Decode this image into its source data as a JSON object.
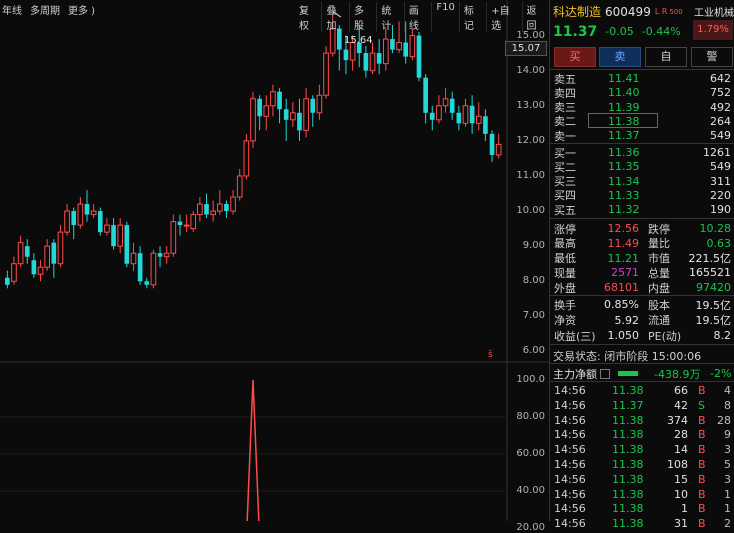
{
  "toolbar_left": [
    "年线",
    "多周期",
    "更多 )"
  ],
  "toolbar_right": [
    "复权",
    "叠加",
    "多股",
    "统计",
    "画线",
    "F10",
    "标记",
    "+自选",
    "返回"
  ],
  "price_axis": [
    "15.00",
    "14.00",
    "13.00",
    "12.00",
    "11.00",
    "10.00",
    "9.00",
    "8.00",
    "7.00",
    "6.00"
  ],
  "current_price_tag": "15.07",
  "high_annotation": "15.64",
  "volume_axis": [
    "100.0",
    "80.00",
    "60.00",
    "40.00",
    "20.00"
  ],
  "small_marker": "š",
  "colors": {
    "up": "#ff4b4b",
    "down": "#22d8d8",
    "green": "#18c64a",
    "bg": "#0b0b0b"
  },
  "stock": {
    "name": "科达制造",
    "code": "600499",
    "tag": "L R",
    "tag_sub": "500",
    "industry": "工业机械",
    "industry_change": "1.79%",
    "price": "11.37",
    "change": "-0.05",
    "change_pct": "-0.44%"
  },
  "buttons": [
    "买",
    "卖",
    "自",
    "警"
  ],
  "sell_orders": [
    {
      "label": "卖五",
      "price": "11.41",
      "vol": "642"
    },
    {
      "label": "卖四",
      "price": "11.40",
      "vol": "752"
    },
    {
      "label": "卖三",
      "price": "11.39",
      "vol": "492"
    },
    {
      "label": "卖二",
      "price": "11.38",
      "vol": "264"
    },
    {
      "label": "卖一",
      "price": "11.37",
      "vol": "549"
    }
  ],
  "buy_orders": [
    {
      "label": "买一",
      "price": "11.36",
      "vol": "1261"
    },
    {
      "label": "买二",
      "price": "11.35",
      "vol": "549"
    },
    {
      "label": "买三",
      "price": "11.34",
      "vol": "311"
    },
    {
      "label": "买四",
      "price": "11.33",
      "vol": "220"
    },
    {
      "label": "买五",
      "price": "11.32",
      "vol": "190"
    }
  ],
  "stats": [
    {
      "l1": "涨停",
      "v1": "12.56",
      "c1": "red",
      "l2": "跌停",
      "v2": "10.28",
      "c2": "green"
    },
    {
      "l1": "最高",
      "v1": "11.49",
      "c1": "red",
      "l2": "量比",
      "v2": "0.63",
      "c2": "green"
    },
    {
      "l1": "最低",
      "v1": "11.21",
      "c1": "green",
      "l2": "市值",
      "v2": "221.5亿",
      "c2": "white"
    },
    {
      "l1": "现量",
      "v1": "2571",
      "c1": "purple",
      "l2": "总量",
      "v2": "165521",
      "c2": "white"
    },
    {
      "l1": "外盘",
      "v1": "68101",
      "c1": "red",
      "l2": "内盘",
      "v2": "97420",
      "c2": "green"
    }
  ],
  "stats2": [
    {
      "l1": "换手",
      "v1": "0.85%",
      "l2": "股本",
      "v2": "19.5亿"
    },
    {
      "l1": "净资",
      "v1": "5.92",
      "l2": "流通",
      "v2": "19.5亿"
    },
    {
      "l1": "收益(三)",
      "v1": "1.050",
      "l2": "PE(动)",
      "v2": "8.2"
    }
  ],
  "trade_status": "交易状态: 闭市阶段 15:00:06",
  "main_flow": {
    "label": "主力净额",
    "value": "-438.9万",
    "pct": "-2%"
  },
  "ticks": [
    {
      "t": "14:56",
      "p": "11.38",
      "v": "66",
      "s": "B",
      "n": "4"
    },
    {
      "t": "14:56",
      "p": "11.37",
      "v": "42",
      "s": "S",
      "n": "8"
    },
    {
      "t": "14:56",
      "p": "11.38",
      "v": "374",
      "s": "B",
      "n": "28"
    },
    {
      "t": "14:56",
      "p": "11.38",
      "v": "28",
      "s": "B",
      "n": "9"
    },
    {
      "t": "14:56",
      "p": "11.38",
      "v": "14",
      "s": "B",
      "n": "3"
    },
    {
      "t": "14:56",
      "p": "11.38",
      "v": "108",
      "s": "B",
      "n": "5"
    },
    {
      "t": "14:56",
      "p": "11.38",
      "v": "15",
      "s": "B",
      "n": "3"
    },
    {
      "t": "14:56",
      "p": "11.38",
      "v": "10",
      "s": "B",
      "n": "1"
    },
    {
      "t": "14:56",
      "p": "11.38",
      "v": "1",
      "s": "B",
      "n": "1"
    },
    {
      "t": "14:56",
      "p": "11.38",
      "v": "31",
      "s": "B",
      "n": "2"
    }
  ],
  "chart_data": {
    "type": "candlestick",
    "ylim": [
      5.9,
      15.5
    ],
    "candles": [
      {
        "o": 8.1,
        "c": 7.9,
        "h": 8.3,
        "l": 7.8
      },
      {
        "o": 8.0,
        "c": 8.5,
        "h": 8.7,
        "l": 7.9
      },
      {
        "o": 8.5,
        "c": 9.1,
        "h": 9.3,
        "l": 8.4
      },
      {
        "o": 9.0,
        "c": 8.7,
        "h": 9.2,
        "l": 8.5
      },
      {
        "o": 8.6,
        "c": 8.2,
        "h": 8.8,
        "l": 8.1
      },
      {
        "o": 8.2,
        "c": 8.4,
        "h": 8.6,
        "l": 8.0
      },
      {
        "o": 8.4,
        "c": 9.0,
        "h": 9.2,
        "l": 8.3
      },
      {
        "o": 9.1,
        "c": 8.5,
        "h": 9.2,
        "l": 8.1
      },
      {
        "o": 8.5,
        "c": 9.4,
        "h": 9.6,
        "l": 8.4
      },
      {
        "o": 9.4,
        "c": 10.0,
        "h": 10.2,
        "l": 9.3
      },
      {
        "o": 10.0,
        "c": 9.6,
        "h": 10.1,
        "l": 9.2
      },
      {
        "o": 9.6,
        "c": 10.2,
        "h": 10.4,
        "l": 9.5
      },
      {
        "o": 10.2,
        "c": 9.9,
        "h": 10.6,
        "l": 9.7
      },
      {
        "o": 9.9,
        "c": 10.0,
        "h": 10.2,
        "l": 9.8
      },
      {
        "o": 10.0,
        "c": 9.4,
        "h": 10.1,
        "l": 9.3
      },
      {
        "o": 9.4,
        "c": 9.6,
        "h": 9.8,
        "l": 9.3
      },
      {
        "o": 9.6,
        "c": 9.0,
        "h": 9.8,
        "l": 8.9
      },
      {
        "o": 9.0,
        "c": 9.6,
        "h": 9.8,
        "l": 8.8
      },
      {
        "o": 9.6,
        "c": 8.5,
        "h": 9.7,
        "l": 8.4
      },
      {
        "o": 8.5,
        "c": 8.8,
        "h": 9.1,
        "l": 8.3
      },
      {
        "o": 8.8,
        "c": 8.0,
        "h": 9.0,
        "l": 7.9
      },
      {
        "o": 8.0,
        "c": 7.9,
        "h": 8.1,
        "l": 7.8
      },
      {
        "o": 7.9,
        "c": 8.8,
        "h": 8.9,
        "l": 7.8
      },
      {
        "o": 8.8,
        "c": 8.7,
        "h": 9.0,
        "l": 8.4
      },
      {
        "o": 8.7,
        "c": 8.8,
        "h": 9.0,
        "l": 8.5
      },
      {
        "o": 8.8,
        "c": 9.7,
        "h": 9.9,
        "l": 8.7
      },
      {
        "o": 9.7,
        "c": 9.6,
        "h": 9.9,
        "l": 9.3
      },
      {
        "o": 9.6,
        "c": 9.6,
        "h": 9.9,
        "l": 9.4
      },
      {
        "o": 9.5,
        "c": 9.9,
        "h": 10.0,
        "l": 9.4
      },
      {
        "o": 9.9,
        "c": 10.2,
        "h": 10.4,
        "l": 9.7
      },
      {
        "o": 10.2,
        "c": 9.9,
        "h": 10.5,
        "l": 9.8
      },
      {
        "o": 9.9,
        "c": 10.0,
        "h": 10.3,
        "l": 9.7
      },
      {
        "o": 10.0,
        "c": 10.2,
        "h": 10.6,
        "l": 9.9
      },
      {
        "o": 10.2,
        "c": 10.0,
        "h": 10.3,
        "l": 9.8
      },
      {
        "o": 10.0,
        "c": 10.4,
        "h": 10.6,
        "l": 9.9
      },
      {
        "o": 10.4,
        "c": 11.0,
        "h": 11.2,
        "l": 10.3
      },
      {
        "o": 11.0,
        "c": 12.0,
        "h": 12.2,
        "l": 10.9
      },
      {
        "o": 12.0,
        "c": 13.2,
        "h": 13.4,
        "l": 11.8
      },
      {
        "o": 13.2,
        "c": 12.7,
        "h": 13.3,
        "l": 12.3
      },
      {
        "o": 12.7,
        "c": 13.0,
        "h": 13.3,
        "l": 12.3
      },
      {
        "o": 13.0,
        "c": 13.4,
        "h": 13.6,
        "l": 12.7
      },
      {
        "o": 13.4,
        "c": 12.9,
        "h": 13.5,
        "l": 12.5
      },
      {
        "o": 12.9,
        "c": 12.6,
        "h": 13.2,
        "l": 12.0
      },
      {
        "o": 12.6,
        "c": 12.8,
        "h": 13.1,
        "l": 12.4
      },
      {
        "o": 12.8,
        "c": 12.3,
        "h": 13.2,
        "l": 12.0
      },
      {
        "o": 12.3,
        "c": 13.2,
        "h": 13.5,
        "l": 12.1
      },
      {
        "o": 13.2,
        "c": 12.8,
        "h": 13.3,
        "l": 12.4
      },
      {
        "o": 12.8,
        "c": 13.3,
        "h": 13.6,
        "l": 12.6
      },
      {
        "o": 13.3,
        "c": 14.5,
        "h": 14.7,
        "l": 13.2
      },
      {
        "o": 14.5,
        "c": 15.2,
        "h": 15.64,
        "l": 14.4
      },
      {
        "o": 15.2,
        "c": 14.6,
        "h": 15.3,
        "l": 14.0
      },
      {
        "o": 14.6,
        "c": 14.3,
        "h": 15.0,
        "l": 13.9
      },
      {
        "o": 14.3,
        "c": 14.8,
        "h": 15.0,
        "l": 14.0
      },
      {
        "o": 14.8,
        "c": 14.5,
        "h": 15.3,
        "l": 14.1
      },
      {
        "o": 14.5,
        "c": 14.0,
        "h": 14.7,
        "l": 13.8
      },
      {
        "o": 14.0,
        "c": 14.5,
        "h": 14.8,
        "l": 13.9
      },
      {
        "o": 14.5,
        "c": 14.2,
        "h": 14.9,
        "l": 13.9
      },
      {
        "o": 14.2,
        "c": 14.9,
        "h": 15.2,
        "l": 14.0
      },
      {
        "o": 14.9,
        "c": 14.6,
        "h": 15.3,
        "l": 14.5
      },
      {
        "o": 14.6,
        "c": 14.8,
        "h": 15.4,
        "l": 14.5
      },
      {
        "o": 14.8,
        "c": 14.4,
        "h": 15.4,
        "l": 14.2
      },
      {
        "o": 14.4,
        "c": 15.0,
        "h": 15.2,
        "l": 14.3
      },
      {
        "o": 15.0,
        "c": 13.8,
        "h": 15.1,
        "l": 13.7
      },
      {
        "o": 13.8,
        "c": 12.8,
        "h": 13.9,
        "l": 12.5
      },
      {
        "o": 12.8,
        "c": 12.6,
        "h": 13.0,
        "l": 12.3
      },
      {
        "o": 12.6,
        "c": 13.0,
        "h": 13.3,
        "l": 12.5
      },
      {
        "o": 13.0,
        "c": 13.2,
        "h": 13.5,
        "l": 12.8
      },
      {
        "o": 13.2,
        "c": 12.8,
        "h": 13.4,
        "l": 12.6
      },
      {
        "o": 12.8,
        "c": 12.5,
        "h": 13.0,
        "l": 12.3
      },
      {
        "o": 12.5,
        "c": 13.0,
        "h": 13.2,
        "l": 12.4
      },
      {
        "o": 13.0,
        "c": 12.5,
        "h": 13.3,
        "l": 12.2
      },
      {
        "o": 12.5,
        "c": 12.7,
        "h": 13.1,
        "l": 12.3
      },
      {
        "o": 12.7,
        "c": 12.2,
        "h": 12.9,
        "l": 12.0
      },
      {
        "o": 12.2,
        "c": 11.6,
        "h": 12.3,
        "l": 11.4
      },
      {
        "o": 11.6,
        "c": 11.9,
        "h": 12.2,
        "l": 11.5
      }
    ],
    "volume_line": {
      "ylim": [
        20,
        100
      ],
      "peak": 100,
      "peak_index": 37
    }
  }
}
